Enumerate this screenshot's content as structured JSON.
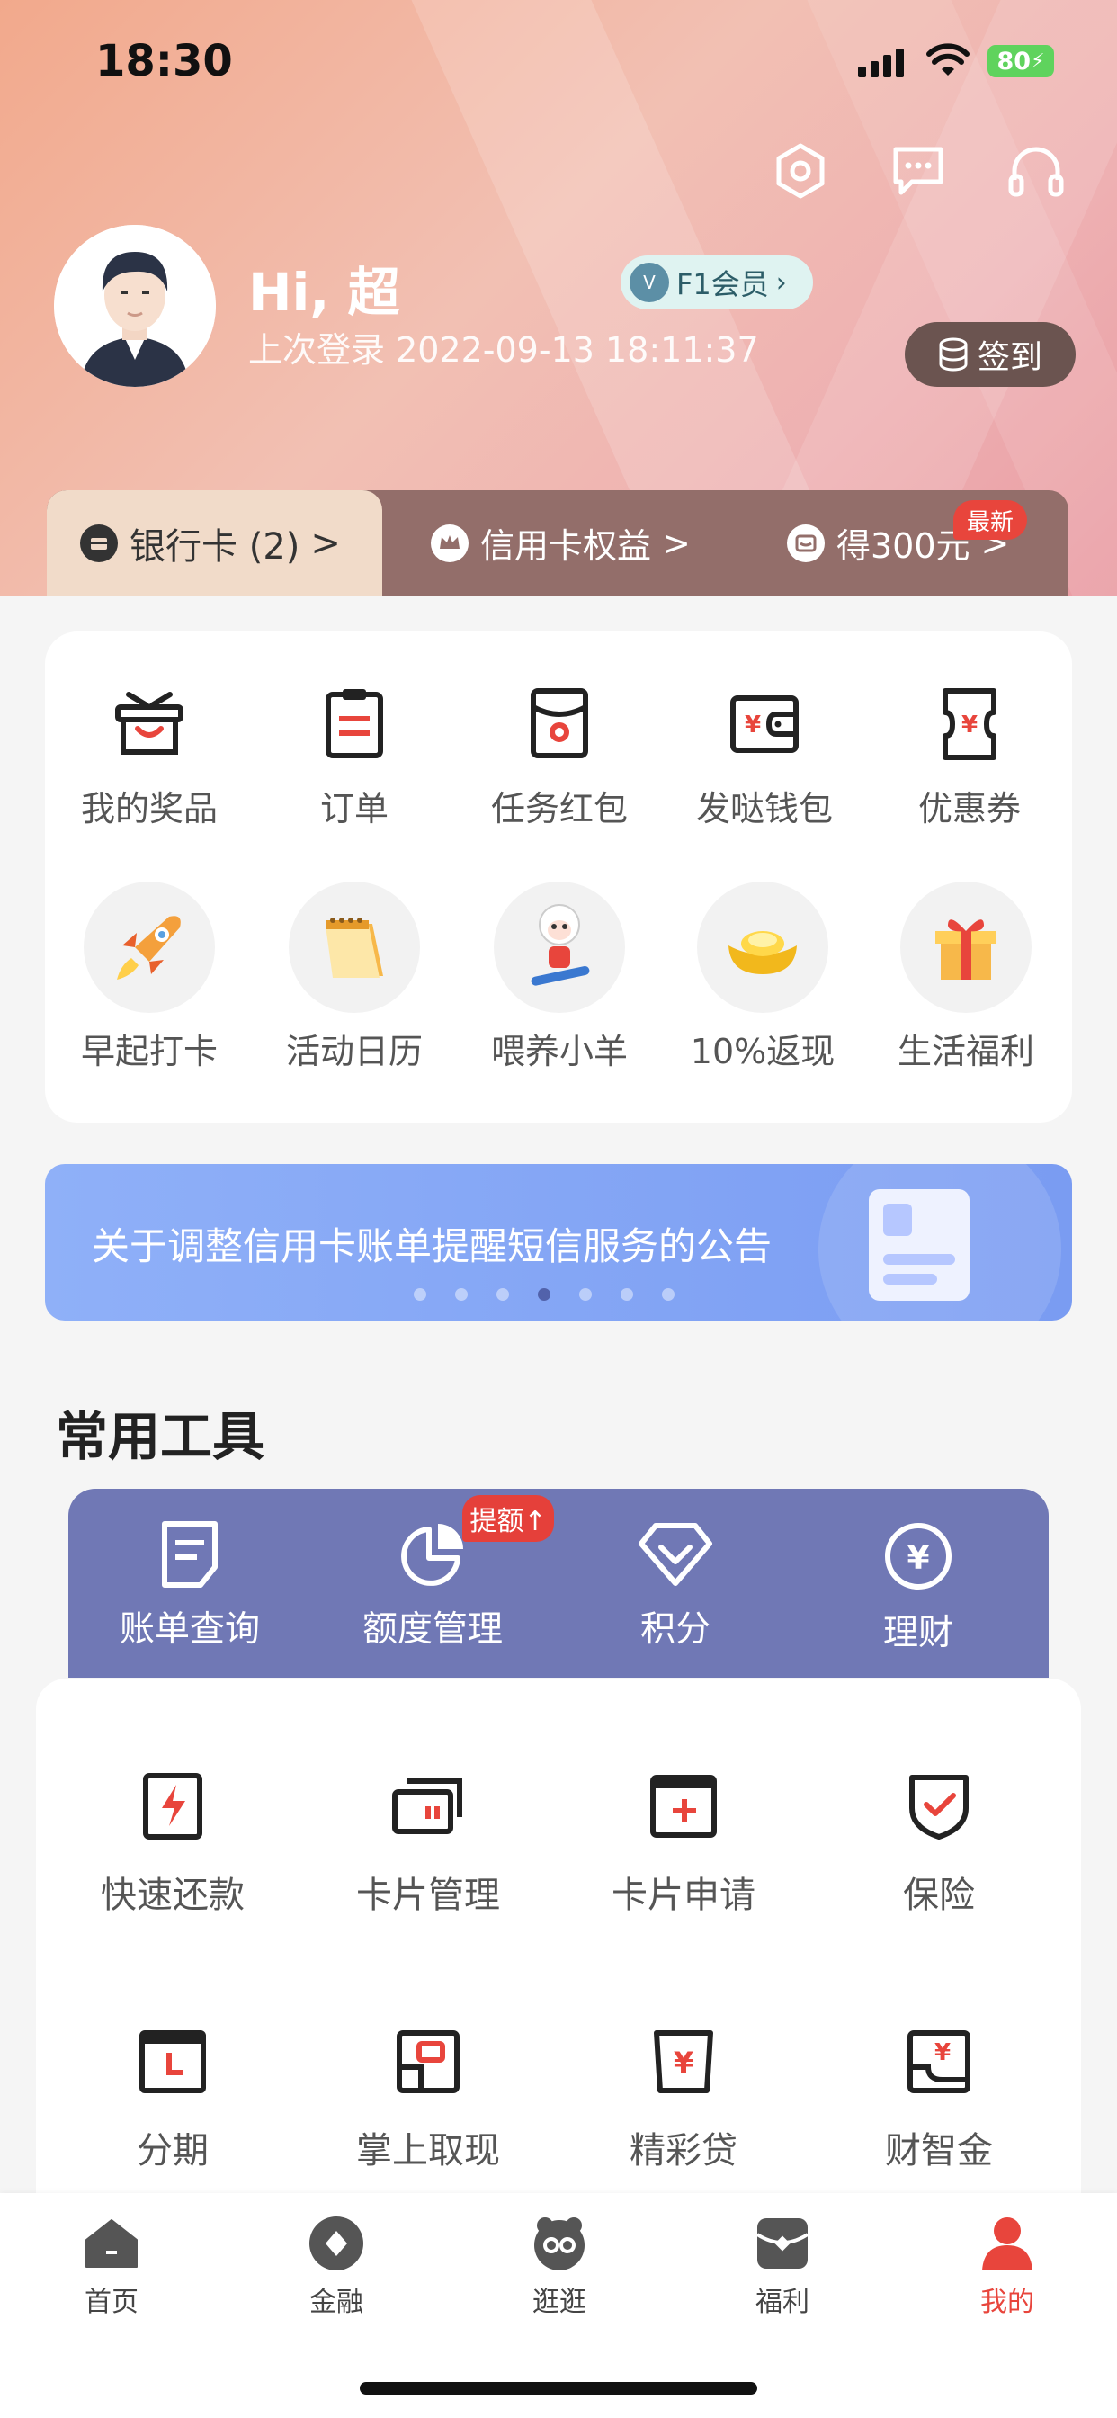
{
  "status_bar": {
    "time": "18:30",
    "battery": "80"
  },
  "header": {
    "greeting": "Hi, 超",
    "last_login": "上次登录 2022-09-13 18:11:37",
    "member_label": "F1会员",
    "member_badge": "V",
    "signin_label": "签到"
  },
  "top_tabs": [
    {
      "label": "银行卡 (2)",
      "arrow": ">"
    },
    {
      "label": "信用卡权益",
      "arrow": ">"
    },
    {
      "label": "得300元",
      "arrow": ">",
      "badge": "最新"
    }
  ],
  "benefits": {
    "row1": [
      {
        "label": "我的奖品",
        "icon": "gift-basket-icon"
      },
      {
        "label": "订单",
        "icon": "clipboard-icon"
      },
      {
        "label": "任务红包",
        "icon": "red-envelope-icon"
      },
      {
        "label": "发哒钱包",
        "icon": "wallet-icon"
      },
      {
        "label": "优惠券",
        "icon": "coupon-icon"
      }
    ],
    "row2": [
      {
        "label": "早起打卡",
        "icon": "rocket-icon"
      },
      {
        "label": "活动日历",
        "icon": "calendar-icon"
      },
      {
        "label": "喂养小羊",
        "icon": "sheep-icon"
      },
      {
        "label": "10%返现",
        "icon": "gold-ingot-icon"
      },
      {
        "label": "生活福利",
        "icon": "gift-box-icon"
      }
    ]
  },
  "banner": {
    "text": "关于调整信用卡账单提醒短信服务的公告",
    "active_dot": 3,
    "dot_count": 7
  },
  "tools": {
    "title": "常用工具",
    "primary": [
      {
        "label": "账单查询",
        "icon": "bill-icon"
      },
      {
        "label": "额度管理",
        "icon": "pie-chart-icon",
        "badge": "提额↑"
      },
      {
        "label": "积分",
        "icon": "diamond-icon"
      },
      {
        "label": "理财",
        "icon": "yuan-coin-icon"
      }
    ],
    "secondary": [
      {
        "label": "快速还款",
        "icon": "lightning-card-icon"
      },
      {
        "label": "卡片管理",
        "icon": "cards-icon"
      },
      {
        "label": "卡片申请",
        "icon": "card-add-icon"
      },
      {
        "label": "保险",
        "icon": "shield-icon"
      },
      {
        "label": "分期",
        "icon": "installment-icon"
      },
      {
        "label": "掌上取现",
        "icon": "cash-withdraw-icon"
      },
      {
        "label": "精彩贷",
        "icon": "loan-icon"
      },
      {
        "label": "财智金",
        "icon": "fund-icon"
      }
    ]
  },
  "nav": [
    {
      "label": "首页",
      "icon": "home-icon"
    },
    {
      "label": "金融",
      "icon": "finance-icon"
    },
    {
      "label": "逛逛",
      "icon": "browse-icon"
    },
    {
      "label": "福利",
      "icon": "welfare-icon"
    },
    {
      "label": "我的",
      "icon": "profile-icon",
      "active": true
    }
  ],
  "colors": {
    "accent": "#e8453c",
    "tools_bg": "#7078b5",
    "banner_bg": "#8fb0f8",
    "active_nav": "#e8453c"
  }
}
